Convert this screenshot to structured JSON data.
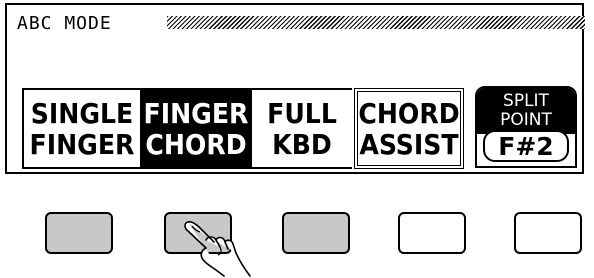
{
  "screen": {
    "title": "ABC MODE",
    "modes": [
      {
        "line1": "SINGLE",
        "line2": "FINGER",
        "selected": false
      },
      {
        "line1": "FINGER",
        "line2": "CHORD",
        "selected": true
      },
      {
        "line1": "FULL",
        "line2": "KBD",
        "selected": false
      },
      {
        "line1": "CHORD",
        "line2": "ASSIST",
        "selected": false
      }
    ],
    "split_point": {
      "line1": "SPLIT",
      "line2": "POINT",
      "value": "F#2"
    }
  },
  "hardware_buttons": [
    {
      "color": "#c8c8c8",
      "pressed": false
    },
    {
      "color": "#c8c8c8",
      "pressed": true
    },
    {
      "color": "#c8c8c8",
      "pressed": false
    },
    {
      "color": "#ffffff",
      "pressed": false
    },
    {
      "color": "#ffffff",
      "pressed": false
    }
  ],
  "icons": {
    "pointer": "pointing-hand-icon"
  }
}
